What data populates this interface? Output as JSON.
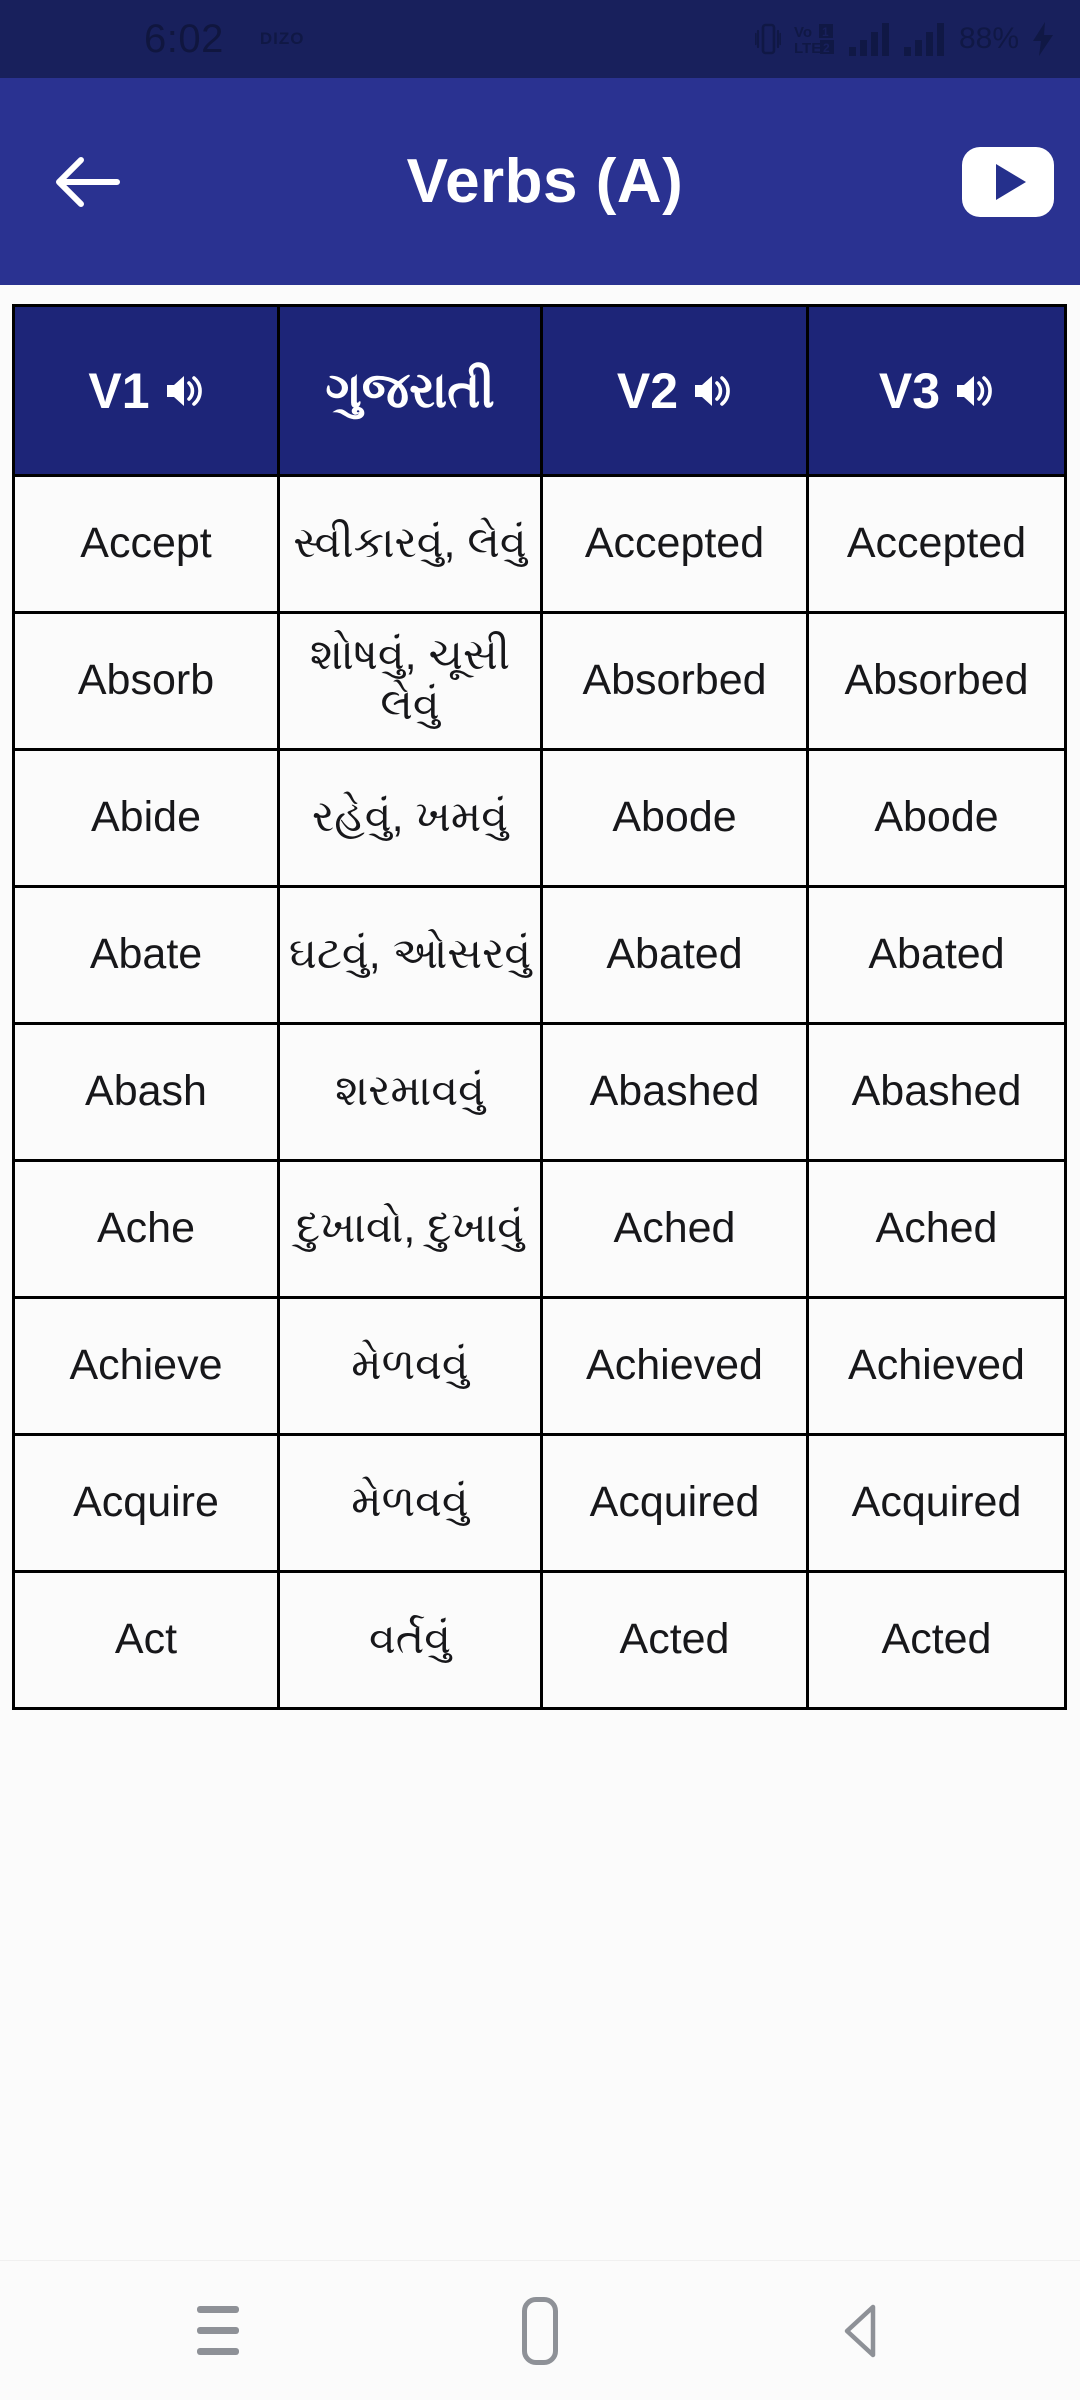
{
  "status_bar": {
    "time": "6:02",
    "carrier": "DIZO",
    "battery": "88%",
    "icons": [
      "vibrate-icon",
      "volte-icon",
      "signal-bars-icon-1",
      "signal-bars-icon-2",
      "charging-bolt-icon"
    ]
  },
  "app_bar": {
    "title": "Verbs (A)",
    "back_icon": "back-arrow-icon",
    "youtube_icon": "youtube-icon"
  },
  "table": {
    "headers": [
      {
        "label": "V1",
        "speaker": true
      },
      {
        "label": "ગુજરાતી",
        "speaker": false
      },
      {
        "label": "V2",
        "speaker": true
      },
      {
        "label": "V3",
        "speaker": true
      }
    ],
    "rows": [
      {
        "v1": "Accept",
        "gujarati": "સ્વીકારવું, લેવું",
        "v2": "Accepted",
        "v3": "Accepted"
      },
      {
        "v1": "Absorb",
        "gujarati": "શોષવું, ચૂસી લેવું",
        "v2": "Absorbed",
        "v3": "Absorbed"
      },
      {
        "v1": "Abide",
        "gujarati": "રહેવું, ખમવું",
        "v2": "Abode",
        "v3": "Abode"
      },
      {
        "v1": "Abate",
        "gujarati": "ઘટવું, ઓસરવું",
        "v2": "Abated",
        "v3": "Abated"
      },
      {
        "v1": "Abash",
        "gujarati": "શરમાવવું",
        "v2": "Abashed",
        "v3": "Abashed"
      },
      {
        "v1": "Ache",
        "gujarati": "દુખાવો, દુખાવું",
        "v2": "Ached",
        "v3": "Ached"
      },
      {
        "v1": "Achieve",
        "gujarati": "મેળવવું",
        "v2": "Achieved",
        "v3": "Achieved"
      },
      {
        "v1": "Acquire",
        "gujarati": "મેળવવું",
        "v2": "Acquired",
        "v3": "Acquired"
      },
      {
        "v1": "Act",
        "gujarati": "વર્તવું",
        "v2": "Acted",
        "v3": "Acted"
      }
    ]
  },
  "nav_bar": {
    "recents_icon": "recents-menu-icon",
    "home_icon": "home-icon",
    "back_icon": "nav-back-icon"
  },
  "colors": {
    "status_bar_bg": "#18205c",
    "app_bar_bg": "#2a3291",
    "table_header_bg": "#1d2578",
    "page_bg": "#fbfbfb",
    "border": "#000000"
  }
}
